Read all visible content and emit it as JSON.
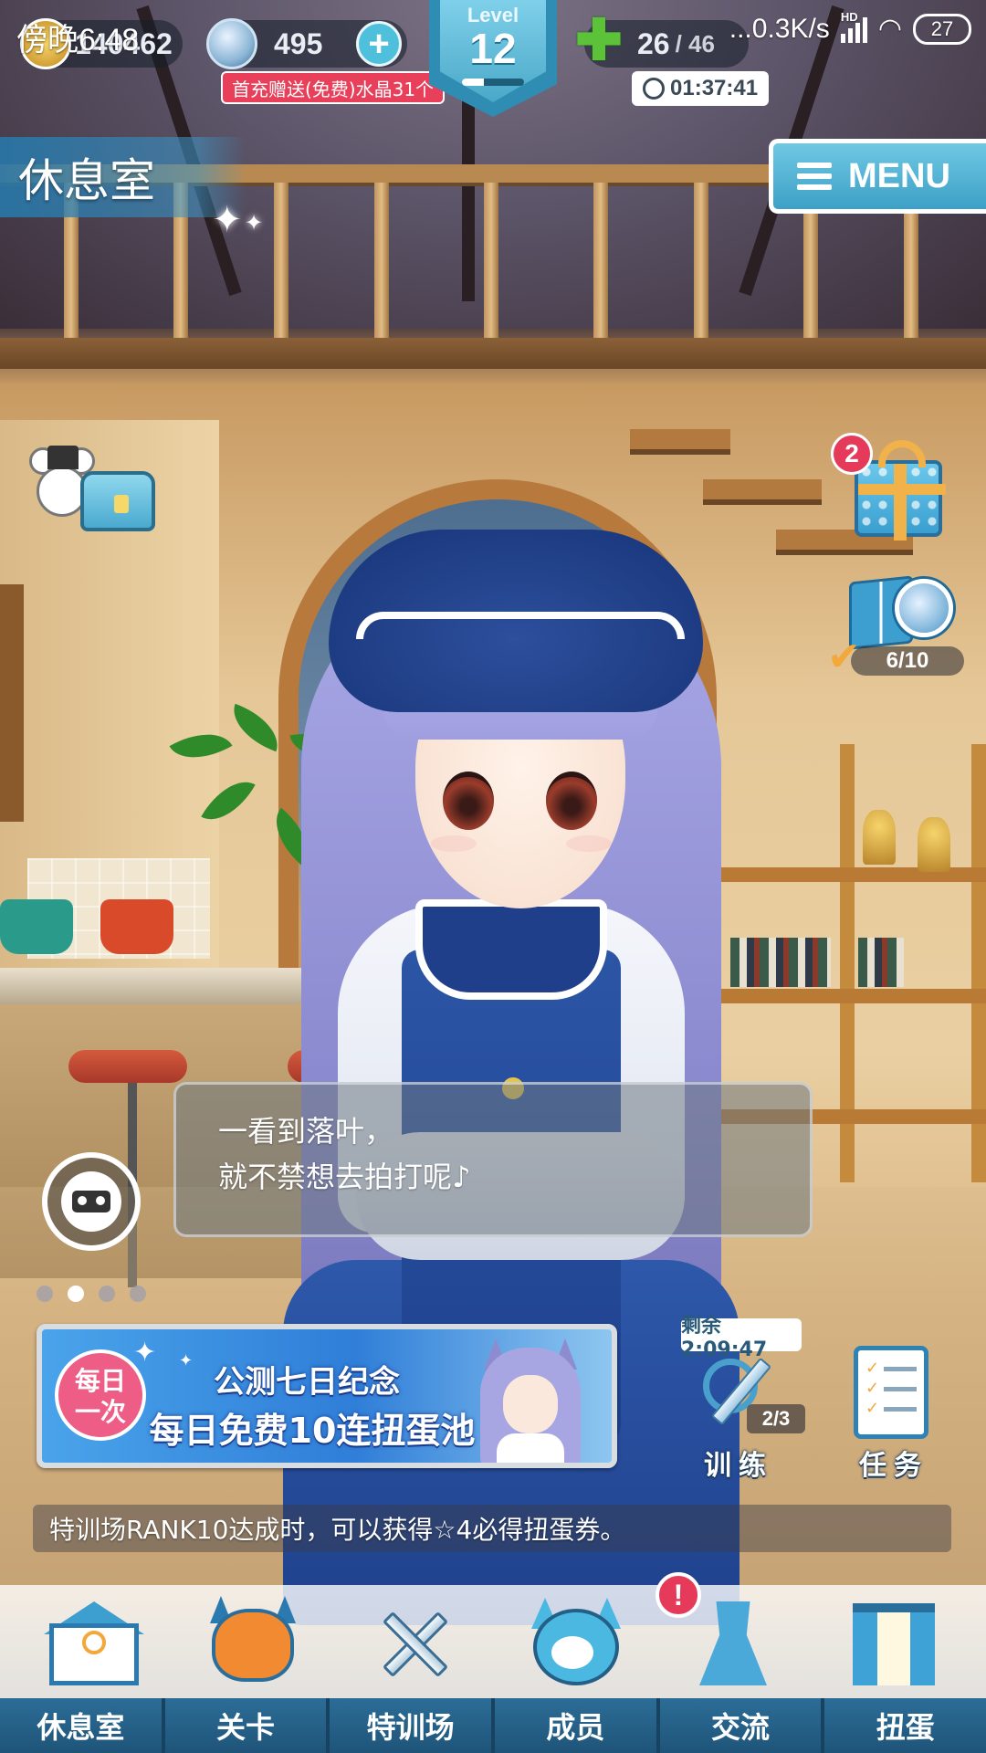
{
  "status_bar": {
    "time": "傍晚6:48",
    "network_speed": "...0.3K/s",
    "hd_label": "HD",
    "battery": "27"
  },
  "hud": {
    "gold": "140462",
    "crystals": "495",
    "promo": "首充赠送(免费)水晶31个",
    "level_label": "Level",
    "level": "12",
    "level_progress": 0.35,
    "stamina": "26",
    "stamina_max": "/ 46",
    "timer": "01:37:41"
  },
  "room": {
    "title": "休息室",
    "menu_label": "MENU"
  },
  "side": {
    "gift_count": "2",
    "collection_progress": "6/10"
  },
  "dialog": {
    "line1": "一看到落叶，",
    "line2": "就不禁想去拍打呢♪"
  },
  "carousel": {
    "active_index": 1,
    "count": 4
  },
  "banner": {
    "badge_line1": "每日",
    "badge_line2": "一次",
    "title": "公测七日纪念",
    "subtitle": "每日免费10连扭蛋池"
  },
  "training": {
    "timer": "剩余2:09:47",
    "count": "2/3",
    "label": "训练"
  },
  "tasks": {
    "label": "任务"
  },
  "ticker": {
    "text": "特训场RANK10达成时，可以获得☆4必得扭蛋券。"
  },
  "nav": {
    "items": [
      {
        "label": "休息室",
        "icon": "school-icon"
      },
      {
        "label": "关卡",
        "icon": "demon-icon"
      },
      {
        "label": "特训场",
        "icon": "crossed-swords-icon"
      },
      {
        "label": "成员",
        "icon": "cat-mascot-icon"
      },
      {
        "label": "交流",
        "icon": "dress-icon"
      },
      {
        "label": "扭蛋",
        "icon": "curtain-icon"
      }
    ],
    "alert": "!"
  },
  "colors": {
    "accent": "#3da0c6",
    "nav_bg": "#1f5479",
    "alert": "#e63a5a"
  }
}
